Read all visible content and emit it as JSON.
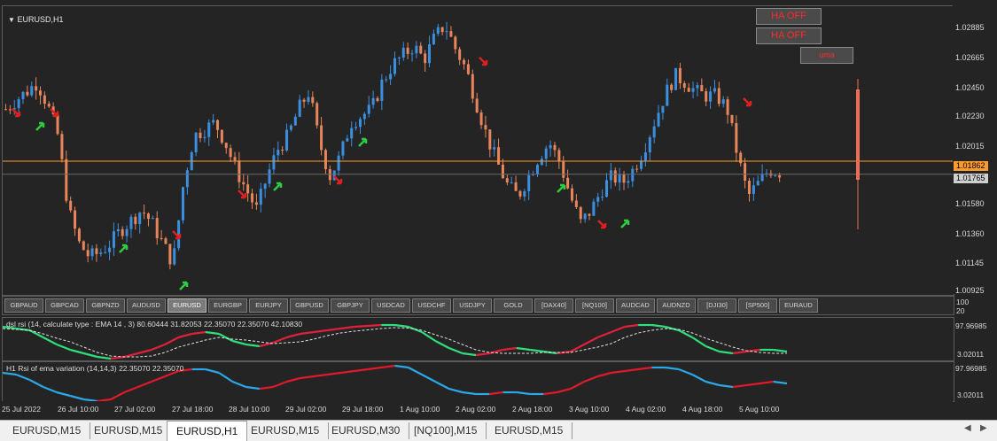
{
  "chart": {
    "title": "EURUSD,H1",
    "current_price": "1.01862",
    "bid_price": "1.01765",
    "price_levels": [
      "1.02885",
      "1.02665",
      "1.02450",
      "1.02230",
      "1.02015",
      "1.01580",
      "1.01360",
      "1.01145",
      "1.00925"
    ],
    "colors": {
      "bull": "#3b8fe0",
      "bear": "#e8855a",
      "price_line": "#ff9a2e",
      "up_arrow": "#2ecc40",
      "down_arrow": "#e02020"
    }
  },
  "buttons": {
    "ha_off_1": "HA OFF",
    "ha_off_2": "HA OFF",
    "uma": "uma"
  },
  "symbols": [
    "GBPAUD",
    "GBPCAD",
    "GBPNZD",
    "AUDUSD",
    "EURUSD",
    "EURGBP",
    "EURJPY",
    "GBPUSD",
    "GBPJPY",
    "USDCAD",
    "USDCHF",
    "USDJPY",
    "GOLD",
    "[DAX40]",
    "[NQ100]",
    "AUDCAD",
    "AUDNZD",
    "[DJI30]",
    "[SP500]",
    "EURAUD"
  ],
  "active_symbol": "EURUSD",
  "symbol_scale": [
    "100",
    "20"
  ],
  "indicator1": {
    "label": "dsl rsi (14, calculate type : EMA  14 , 3) 80.60444 31.82053 22.35070 22.35070 42.10830",
    "scale_top": "97.96985",
    "scale_bottom": "3.02011"
  },
  "indicator2": {
    "label": "H1 Rsi of ema variation (14,14,3) 22.35070 22.35070",
    "scale_top": "97.96985",
    "scale_bottom": "3.02011"
  },
  "time_labels": [
    "25 Jul 2022",
    "26 Jul 10:00",
    "27 Jul 02:00",
    "27 Jul 18:00",
    "28 Jul 10:00",
    "29 Jul 02:00",
    "29 Jul 18:00",
    "1 Aug 10:00",
    "2 Aug 02:00",
    "2 Aug 18:00",
    "3 Aug 10:00",
    "4 Aug 02:00",
    "4 Aug 18:00",
    "5 Aug 10:00"
  ],
  "tabs": [
    "EURUSD,M15",
    "EURUSD,M15",
    "EURUSD,H1",
    "EURUSD,M15",
    "EURUSD,M30",
    "[NQ100],M15",
    "EURUSD,M15"
  ],
  "active_tab": "EURUSD,H1",
  "chart_data": {
    "type": "candlestick",
    "price_path": [
      1.0225,
      1.0232,
      1.0238,
      1.0245,
      1.0228,
      1.0205,
      1.015,
      1.0125,
      1.0115,
      1.0118,
      1.0125,
      1.0135,
      1.0142,
      1.015,
      1.014,
      1.0125,
      1.011,
      1.017,
      1.0205,
      1.021,
      1.0215,
      1.02,
      1.018,
      1.0165,
      1.015,
      1.0175,
      1.0195,
      1.0205,
      1.0225,
      1.0238,
      1.02,
      1.0175,
      1.019,
      1.0215,
      1.022,
      1.0225,
      1.0245,
      1.0258,
      1.0265,
      1.0272,
      1.0262,
      1.0278,
      1.0288,
      1.027,
      1.0255,
      1.023,
      1.0205,
      1.0185,
      1.0168,
      1.016,
      1.0175,
      1.019,
      1.02,
      1.0185,
      1.016,
      1.014,
      1.015,
      1.0165,
      1.0175,
      1.017,
      1.018,
      1.0195,
      1.0215,
      1.0235,
      1.025,
      1.0245,
      1.0238,
      1.0235,
      1.0235,
      1.0225,
      1.019,
      1.016,
      1.017,
      1.018,
      1.0178
    ]
  }
}
